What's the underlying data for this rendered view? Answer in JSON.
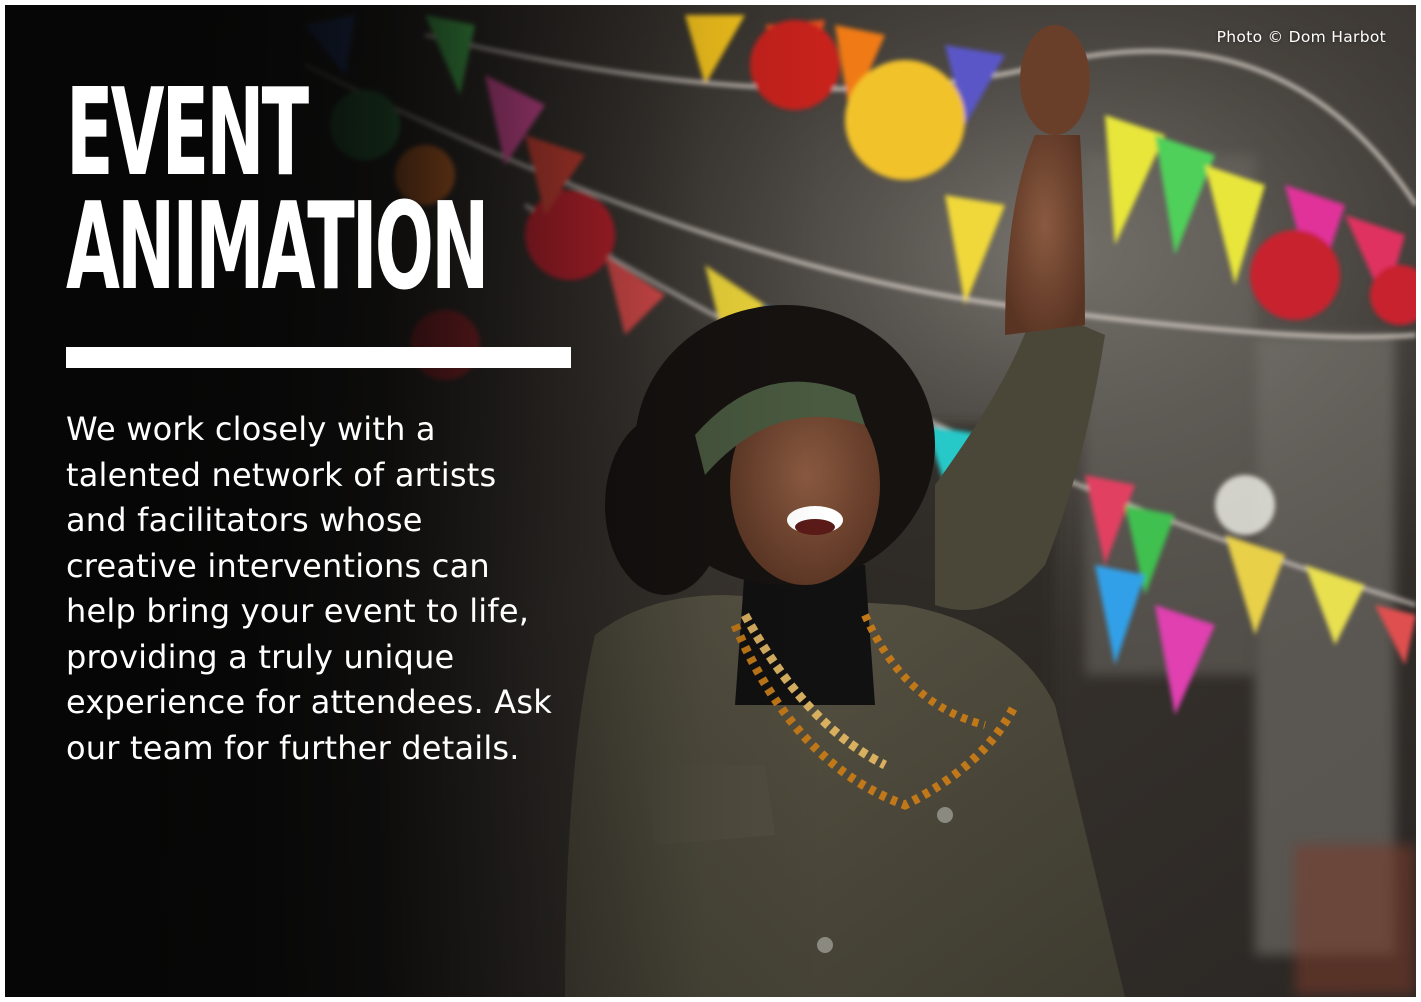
{
  "hero": {
    "title_lines": [
      "EVENT",
      "ANIMATION"
    ],
    "body_lines": [
      "We work closely with a",
      "talented network of artists",
      "and facilitators whose",
      "creative interventions can",
      "help bring your event to life,",
      "providing a truly unique",
      "experience for attendees. Ask",
      "our team for further details."
    ],
    "photo_credit": "Photo © Dom Harbot"
  },
  "colors": {
    "background_dark": "#0a0a0a",
    "text": "#ffffff",
    "rule": "#ffffff"
  }
}
